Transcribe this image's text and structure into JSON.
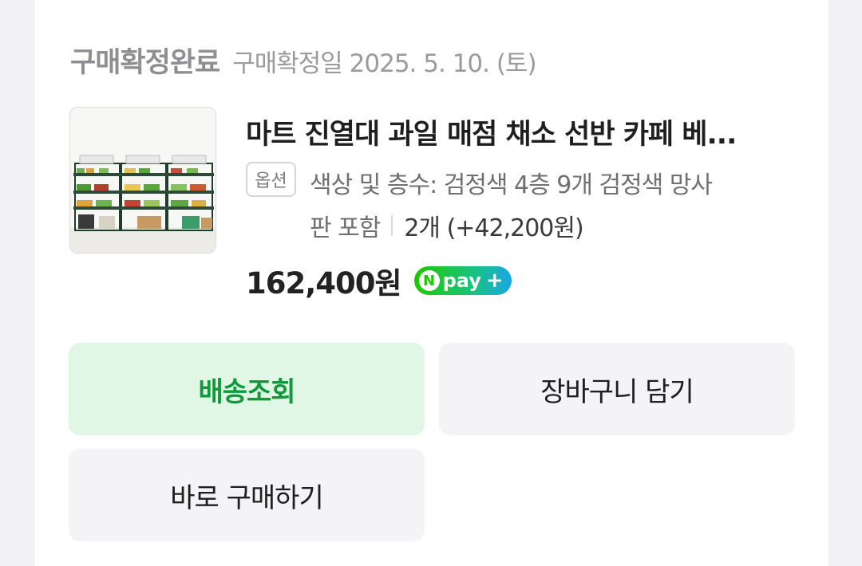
{
  "order": {
    "status": "구매확정완료",
    "confirm_date": "구매확정일 2025. 5. 10. (토)"
  },
  "product": {
    "title": "마트 진열대 과일 매점 채소 선반 카페 베...",
    "option_badge": "옵션",
    "option_text_line1": "색상 및 층수: 검정색 4층 9개 검정색 망사",
    "option_text_line2": "판 포함",
    "quantity": "2개 (+42,200원)",
    "price": "162,400원",
    "npay": {
      "n": "N",
      "label": "pay",
      "plus": "+"
    }
  },
  "actions": {
    "track_delivery": "배송조회",
    "add_to_cart": "장바구니 담기",
    "buy_now": "바로 구매하기"
  },
  "colors": {
    "track_bg": "#dff7e4",
    "track_text": "#0f9a3a",
    "neutral_btn_bg": "#f4f4f6",
    "npay_green": "#1ec800"
  },
  "icons": {
    "thumbnail": "product-shelf-image"
  }
}
